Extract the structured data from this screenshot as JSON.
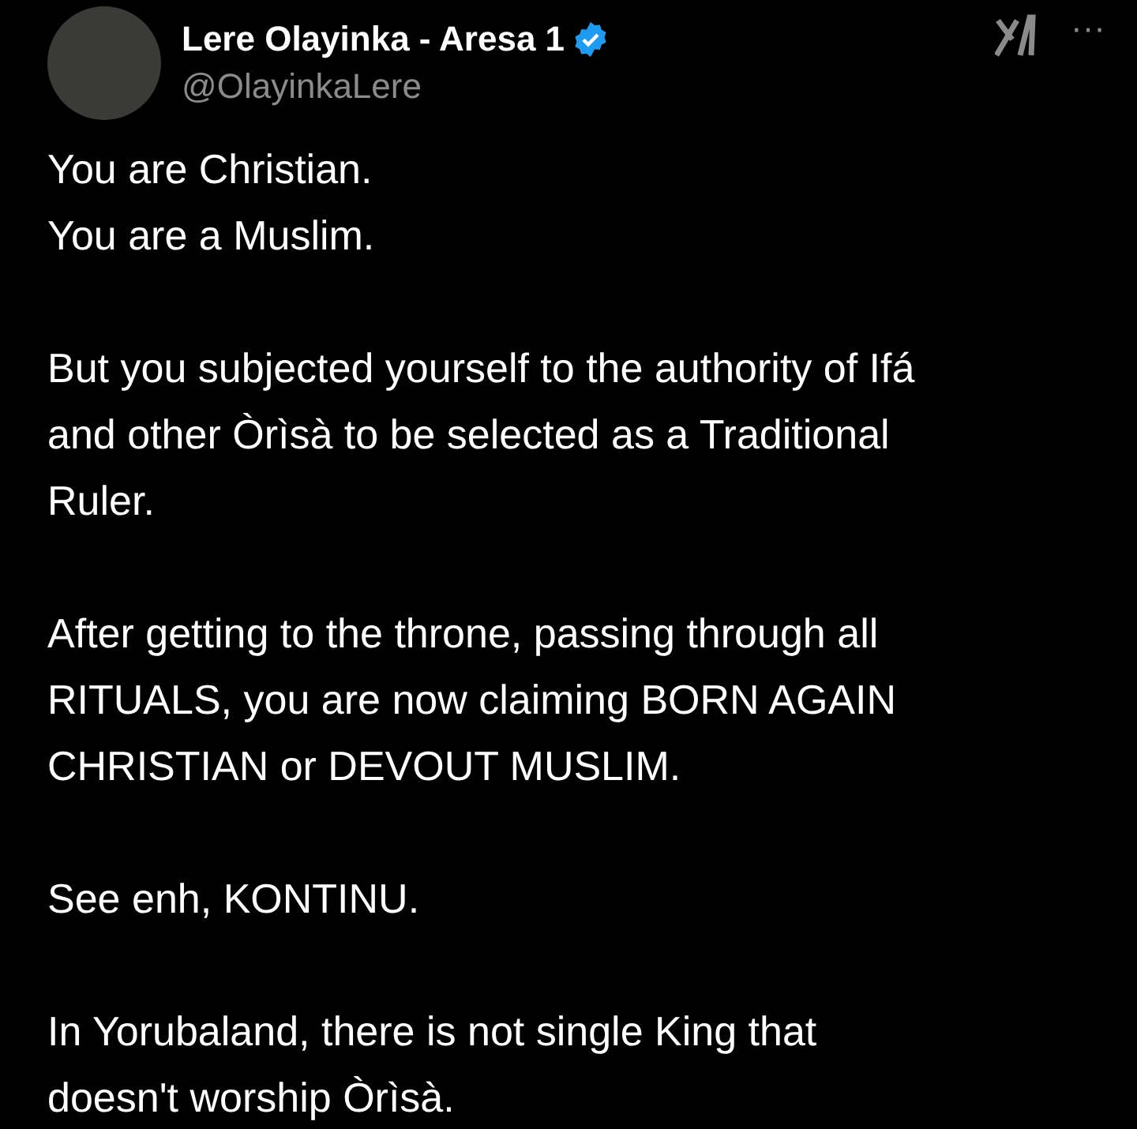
{
  "author": {
    "name": "Lere Olayinka - Aresa 1",
    "verified": true,
    "handle": "@OlayinkaLere"
  },
  "menu_icon": "···",
  "paragraphs": [
    [
      "You are Christian.",
      "You are a Muslim."
    ],
    [
      "But you subjected yourself to the authority of Ifá",
      "and other Òrìsà to be selected as a Traditional",
      "Ruler."
    ],
    [
      "After getting to the throne, passing through all",
      "RITUALS, you are now claiming BORN AGAIN",
      "CHRISTIAN or DEVOUT MUSLIM."
    ],
    [
      "See enh, KONTINU."
    ],
    [
      "In Yorubaland, there is not single King that",
      "doesn't worship Òrìsà."
    ]
  ]
}
